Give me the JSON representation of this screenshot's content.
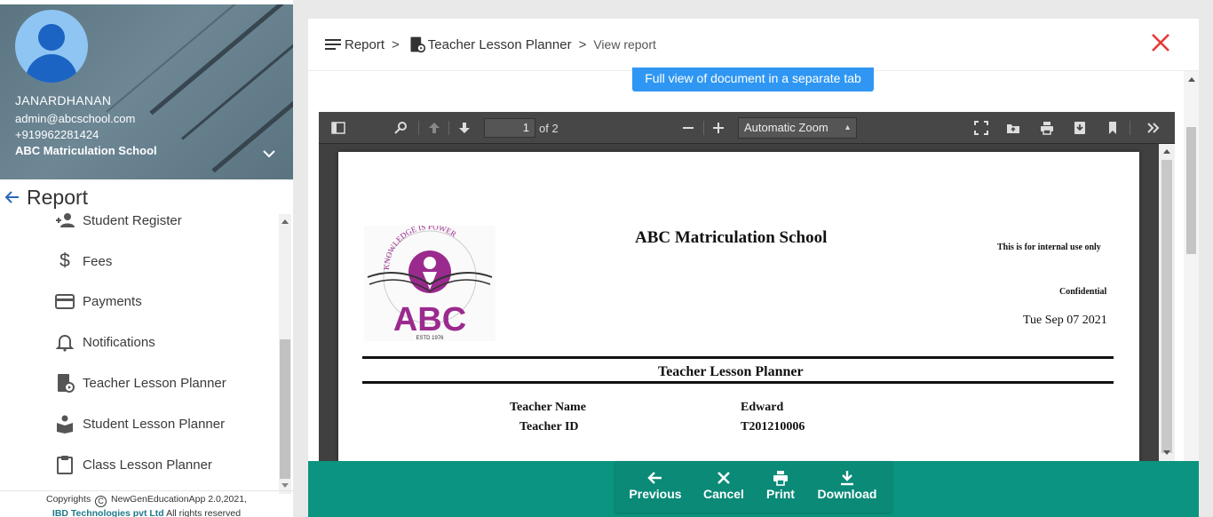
{
  "profile": {
    "name": "JANARDHANAN",
    "email": "admin@abcschool.com",
    "phone": "+919962281424",
    "school": "ABC Matriculation School"
  },
  "sidebar": {
    "section_title": "Report",
    "items": [
      {
        "label": "Student Register",
        "icon": "add-person-icon"
      },
      {
        "label": "Fees",
        "icon": "dollar-icon"
      },
      {
        "label": "Payments",
        "icon": "credit-card-icon"
      },
      {
        "label": "Notifications",
        "icon": "bell-icon"
      },
      {
        "label": "Teacher Lesson Planner",
        "icon": "teacher-planner-icon"
      },
      {
        "label": "Student Lesson Planner",
        "icon": "student-reading-icon"
      },
      {
        "label": "Class Lesson Planner",
        "icon": "clipboard-icon"
      }
    ],
    "footer": {
      "copyright_prefix": "Copyrights",
      "copyright_app": "NewGenEducationApp 2.0,2021,",
      "company": "IBD Technologies pvt Ltd",
      "rights": "All rights reserved"
    }
  },
  "breadcrumb": {
    "root": "Report",
    "sep": ">",
    "page": "Teacher Lesson Planner",
    "current": "View report"
  },
  "fullview_button": "Full view of document in a separate tab",
  "viewer": {
    "page_number": "1",
    "page_total": "of 2",
    "zoom": "Automatic Zoom"
  },
  "document": {
    "school": "ABC Matriculation School",
    "note": "This is for internal use only",
    "confidential": "Confidential",
    "date": "Tue Sep 07 2021",
    "title": "Teacher Lesson Planner",
    "fields": [
      {
        "label": "Teacher Name",
        "value": "Edward"
      },
      {
        "label": "Teacher ID",
        "value": "T201210006"
      }
    ],
    "logo": {
      "arc_text": "KNOWLEDGE IS POWER",
      "letters": "ABC",
      "estd": "ESTD 1976"
    }
  },
  "actions": {
    "previous": "Previous",
    "cancel": "Cancel",
    "print": "Print",
    "download": "Download"
  },
  "colors": {
    "accent_green": "#0b9480",
    "close_red": "#e53935",
    "button_blue": "#2f97f3",
    "logo_purple": "#9b2a8f"
  }
}
